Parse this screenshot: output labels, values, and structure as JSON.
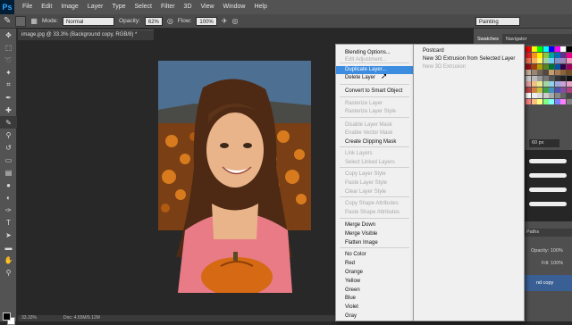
{
  "app": {
    "logo": "Ps"
  },
  "menubar": [
    "File",
    "Edit",
    "Image",
    "Layer",
    "Type",
    "Select",
    "Filter",
    "3D",
    "View",
    "Window",
    "Help"
  ],
  "options": {
    "mode_label": "Mode:",
    "mode_value": "Normal",
    "opacity_label": "Opacity:",
    "opacity_value": "62%",
    "flow_label": "Flow:",
    "flow_value": "100%",
    "workspace": "Painting"
  },
  "document": {
    "tab_title": "image.jpg @ 33.3% (Background copy, RGB/8) *"
  },
  "status": {
    "zoom": "33.33%",
    "doc": "Doc: 4.55M/9.12M"
  },
  "panels": {
    "tabs": [
      "Swatches",
      "Navigator"
    ],
    "brush_size": "60 px",
    "layers_tab": "Paths",
    "opacity_label": "Opacity:",
    "opacity_value": "100%",
    "fill_label": "Fill:",
    "fill_value": "100%",
    "selected_layer": "nd copy"
  },
  "context_menu": {
    "items": [
      {
        "label": "Blending Options...",
        "enabled": true
      },
      {
        "label": "Edit Adjustment...",
        "enabled": false
      },
      {
        "label": "Duplicate Layer...",
        "enabled": true,
        "highlighted": true
      },
      {
        "label": "Delete Layer",
        "enabled": true
      },
      {
        "label": "Convert to Smart Object",
        "enabled": true
      },
      {
        "label": "Rasterize Layer",
        "enabled": false
      },
      {
        "label": "Rasterize Layer Style",
        "enabled": false
      },
      {
        "label": "Disable Layer Mask",
        "enabled": false
      },
      {
        "label": "Enable Vector Mask",
        "enabled": false
      },
      {
        "label": "Create Clipping Mask",
        "enabled": true
      },
      {
        "label": "Link Layers",
        "enabled": false
      },
      {
        "label": "Select Linked Layers",
        "enabled": false
      },
      {
        "label": "Copy Layer Style",
        "enabled": false
      },
      {
        "label": "Paste Layer Style",
        "enabled": false
      },
      {
        "label": "Clear Layer Style",
        "enabled": false
      },
      {
        "label": "Copy Shape Attributes",
        "enabled": false
      },
      {
        "label": "Paste Shape Attributes",
        "enabled": false
      },
      {
        "label": "Merge Down",
        "enabled": true
      },
      {
        "label": "Merge Visible",
        "enabled": true
      },
      {
        "label": "Flatten Image",
        "enabled": true
      },
      {
        "label": "No Color",
        "enabled": true
      },
      {
        "label": "Red",
        "enabled": true
      },
      {
        "label": "Orange",
        "enabled": true
      },
      {
        "label": "Yellow",
        "enabled": true
      },
      {
        "label": "Green",
        "enabled": true
      },
      {
        "label": "Blue",
        "enabled": true
      },
      {
        "label": "Violet",
        "enabled": true
      },
      {
        "label": "Gray",
        "enabled": true
      }
    ]
  },
  "submenu": {
    "items": [
      {
        "label": "Postcard",
        "enabled": true
      },
      {
        "label": "New 3D Extrusion from Selected Layer",
        "enabled": true
      },
      {
        "label": "New 3D Extrusion",
        "enabled": false
      }
    ]
  },
  "colors": {
    "highlight": "#3c8ce0",
    "foreground": "#000000",
    "background": "#ffffff"
  }
}
